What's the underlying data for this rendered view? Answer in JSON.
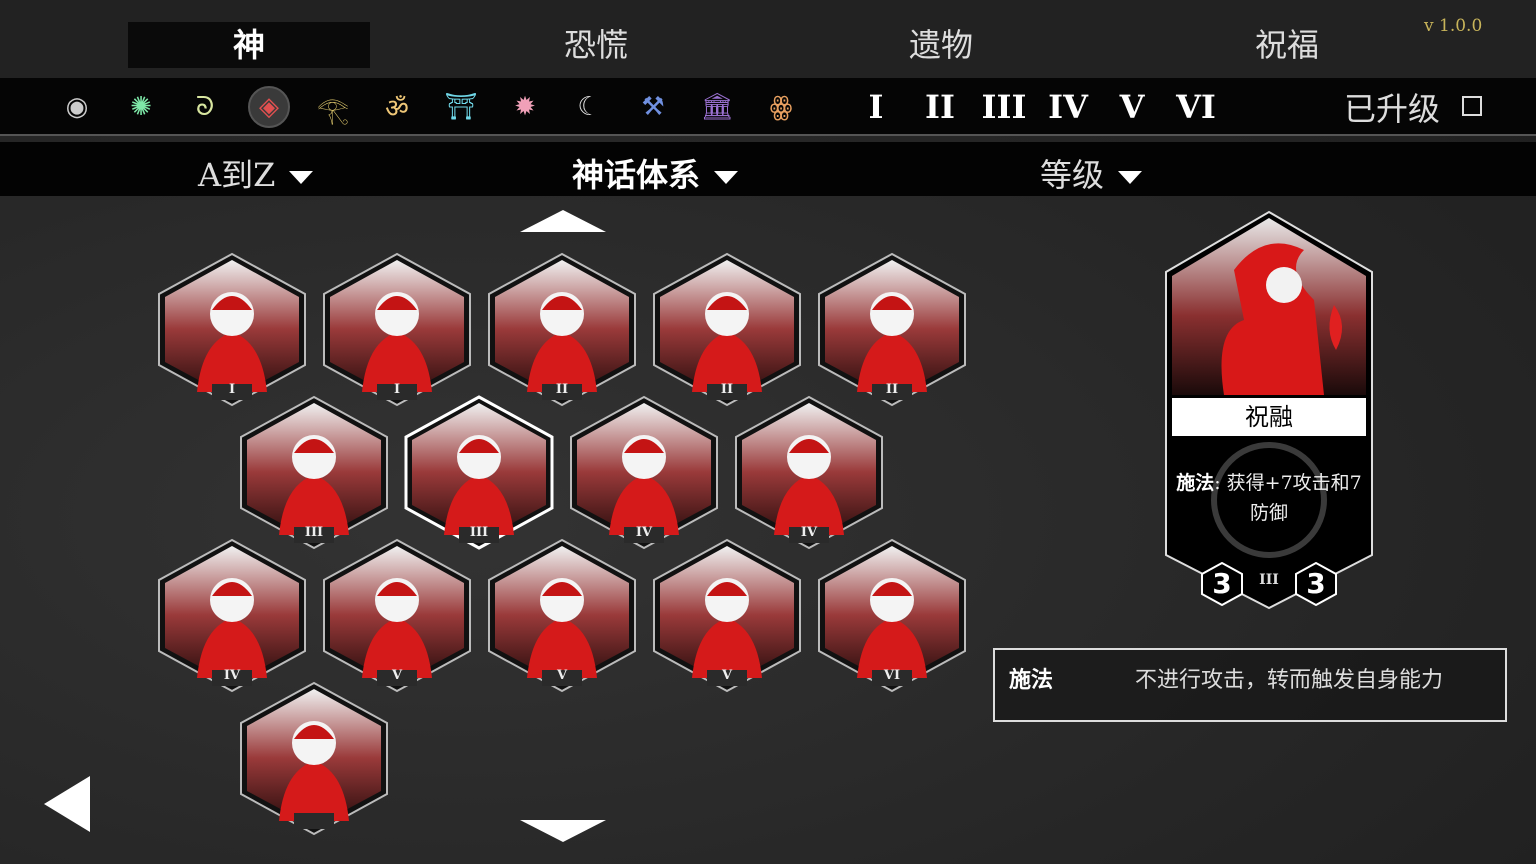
{
  "version": "v 1.0.0",
  "tabs": [
    {
      "label": "神",
      "active": true
    },
    {
      "label": "恐慌",
      "active": false
    },
    {
      "label": "遗物",
      "active": false
    },
    {
      "label": "祝福",
      "active": false
    }
  ],
  "mythology_icons": [
    {
      "name": "world-icon",
      "glyph": "◉",
      "color": "#cccccc"
    },
    {
      "name": "aztec-sun-icon",
      "glyph": "✺",
      "color": "#7ee8a8"
    },
    {
      "name": "triskele-icon",
      "glyph": "ᘐ",
      "color": "#d8e6a0"
    },
    {
      "name": "chinese-icon",
      "glyph": "◈",
      "color": "#e05050",
      "selected": true
    },
    {
      "name": "eye-of-ra-icon",
      "glyph": "𓂀",
      "color": "#e8d070"
    },
    {
      "name": "om-icon",
      "glyph": "ॐ",
      "color": "#f0c878"
    },
    {
      "name": "torii-icon",
      "glyph": "⛩",
      "color": "#70d8e8"
    },
    {
      "name": "sun-wheel-icon",
      "glyph": "✹",
      "color": "#f0a0b8"
    },
    {
      "name": "moon-icon",
      "glyph": "☾",
      "color": "#dddddd"
    },
    {
      "name": "hammer-icon",
      "glyph": "⚒",
      "color": "#7090e0"
    },
    {
      "name": "temple-icon",
      "glyph": "🏛",
      "color": "#9a70d0"
    },
    {
      "name": "glyph-icon",
      "glyph": "ꙮ",
      "color": "#e8a060"
    }
  ],
  "tiers": [
    "I",
    "II",
    "III",
    "IV",
    "V",
    "VI"
  ],
  "upgraded_label": "已升级",
  "sort": {
    "alpha": "A到Z",
    "mythology": "神话体系",
    "level": "等级"
  },
  "gods": [
    {
      "tier": "I"
    },
    {
      "tier": "I"
    },
    {
      "tier": "II"
    },
    {
      "tier": "II"
    },
    {
      "tier": "II"
    },
    {
      "tier": "III"
    },
    {
      "tier": "III"
    },
    {
      "tier": "IV"
    },
    {
      "tier": "IV"
    },
    {
      "tier": "IV"
    },
    {
      "tier": "V"
    },
    {
      "tier": "V"
    },
    {
      "tier": "V"
    },
    {
      "tier": "VI"
    },
    {
      "tier": ""
    }
  ],
  "detail": {
    "name": "祝融",
    "desc_keyword": "施法",
    "desc_text": ": 获得+7攻击和7防御",
    "attack": "3",
    "tier": "III",
    "defense": "3"
  },
  "keyword_box": {
    "title": "施法",
    "text": "不进行攻击，转而触发自身能力"
  }
}
